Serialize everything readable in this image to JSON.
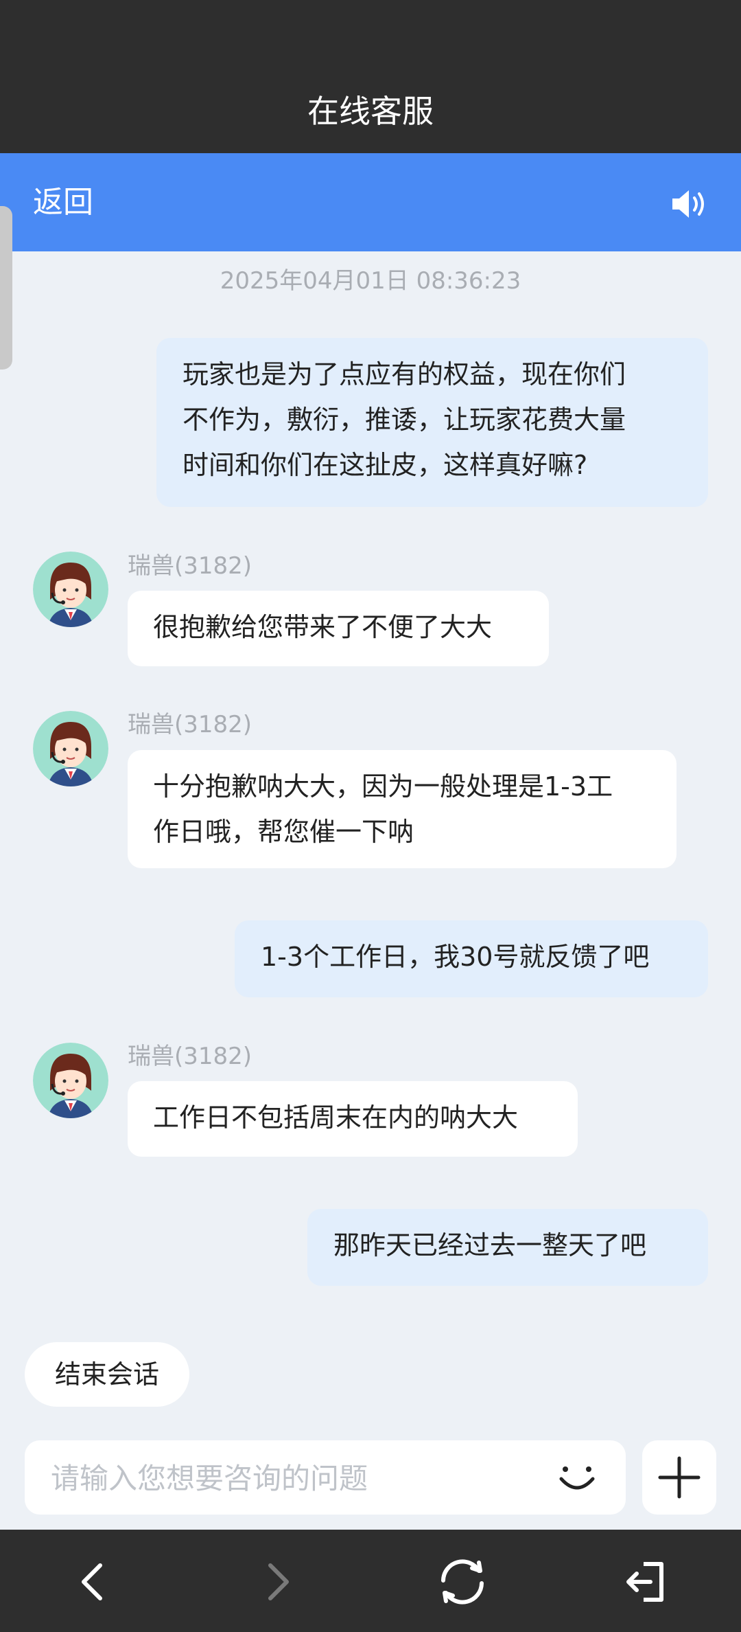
{
  "app": {
    "title": "在线客服"
  },
  "header": {
    "back_label": "返回",
    "sound_icon": "speaker-volume-icon"
  },
  "chat": {
    "timestamp": "2025年04月01日 08:36:23",
    "messages": [
      {
        "role": "user",
        "lines": [
          "玩家也是为了点应有的权益，现在你们",
          "不作为，敷衍，推诿，让玩家花费大量",
          "时间和你们在这扯皮，这样真好嘛?"
        ]
      },
      {
        "role": "agent",
        "name": "瑞兽(3182)",
        "lines": [
          "很抱歉给您带来了不便了大大"
        ]
      },
      {
        "role": "agent",
        "name": "瑞兽(3182)",
        "lines": [
          "十分抱歉呐大大，因为一般处理是1-3工",
          "作日哦，帮您催一下呐"
        ]
      },
      {
        "role": "user",
        "lines": [
          "1-3个工作日，我30号就反馈了吧"
        ]
      },
      {
        "role": "agent",
        "name": "瑞兽(3182)",
        "lines": [
          "工作日不包括周末在内的呐大大"
        ]
      },
      {
        "role": "user",
        "lines": [
          "那昨天已经过去一整天了吧"
        ]
      }
    ]
  },
  "actions": {
    "end_session": "结束会话"
  },
  "composer": {
    "placeholder": "请输入您想要咨询的问题",
    "emoji_icon": "smiley-icon",
    "plus_icon": "plus-icon"
  },
  "navigation": {
    "icons": [
      "chevron-left-icon",
      "chevron-right-icon",
      "refresh-icon",
      "exit-icon"
    ]
  },
  "colors": {
    "title_bar": "#2e2e2e",
    "header_blue": "#4a8af4",
    "background": "#edf1f6",
    "user_bubble": "#e2eefc",
    "agent_bubble": "#ffffff",
    "muted_text": "#a9adb3"
  }
}
